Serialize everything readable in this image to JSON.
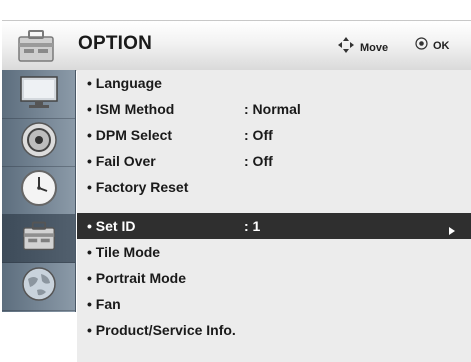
{
  "header": {
    "title": "OPTION",
    "move_label": "Move",
    "ok_label": "OK",
    "icon": "toolbox-icon"
  },
  "sidebar": {
    "items": [
      {
        "icon": "monitor-icon",
        "active": false
      },
      {
        "icon": "speaker-icon",
        "active": false
      },
      {
        "icon": "clock-icon",
        "active": false
      },
      {
        "icon": "toolbox-icon",
        "active": true
      },
      {
        "icon": "globe-icon",
        "active": false
      }
    ]
  },
  "menu": {
    "items": [
      {
        "name": "• Language",
        "value": ""
      },
      {
        "name": "• ISM Method",
        "value": ": Normal"
      },
      {
        "name": "• DPM Select",
        "value": ": Off"
      },
      {
        "name": "• Fail Over",
        "value": ": Off"
      },
      {
        "name": "• Factory Reset",
        "value": ""
      },
      {
        "name": "• Set ID",
        "value": ": 1",
        "selected": true
      },
      {
        "name": "• Tile Mode",
        "value": ""
      },
      {
        "name": "• Portrait Mode",
        "value": ""
      },
      {
        "name": "• Fan",
        "value": ""
      },
      {
        "name": "• Product/Service Info.",
        "value": ""
      }
    ]
  },
  "colors": {
    "selected_bg": "#2f2f2f",
    "menu_bg": "#ececec",
    "sidebar": "#6e7e8c"
  }
}
